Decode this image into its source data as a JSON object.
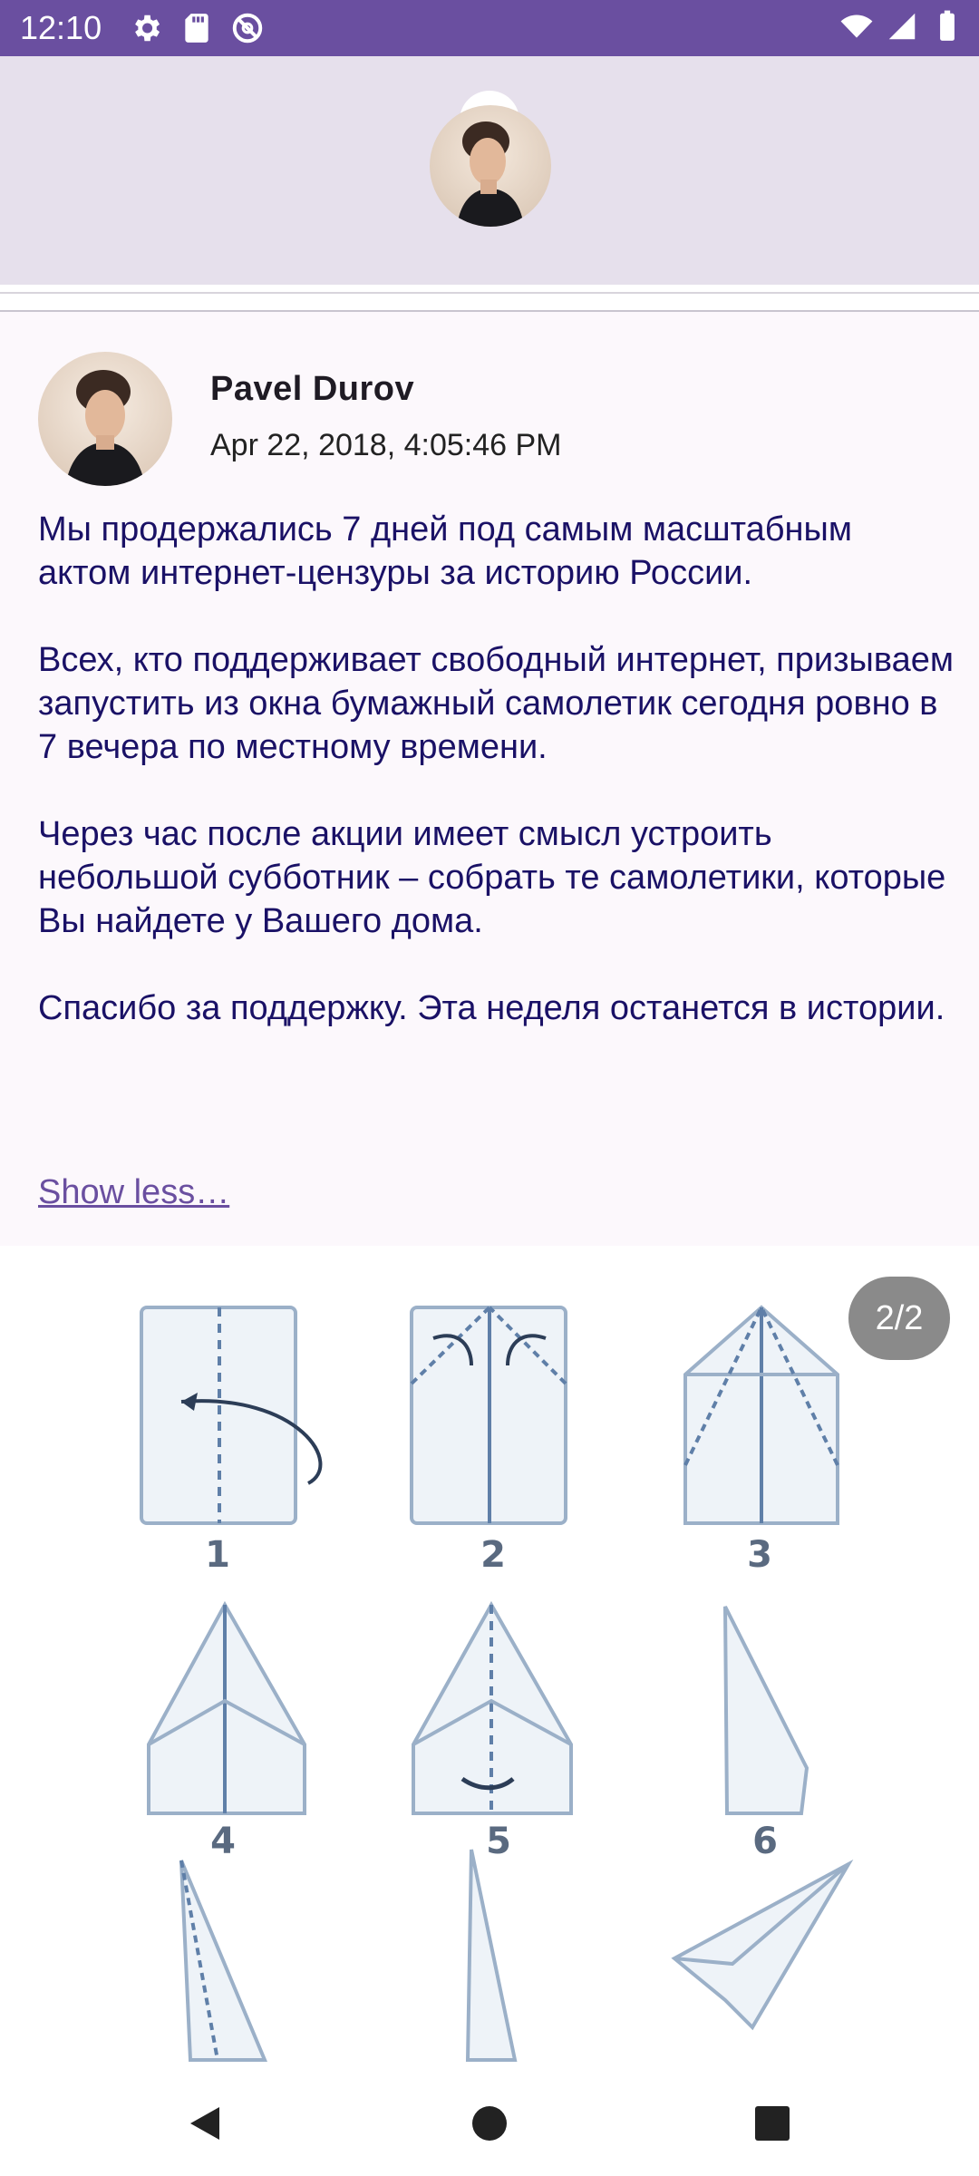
{
  "status_bar": {
    "time": "12:10",
    "icons_left": [
      "gear-icon",
      "sd-card-icon",
      "do-not-disturb-icon"
    ],
    "icons_right": [
      "wifi-icon",
      "signal-icon",
      "battery-icon"
    ]
  },
  "header": {
    "avatar_icon": "profile-avatar"
  },
  "post": {
    "author": "Pavel Durov",
    "date": "Apr 22, 2018, 4:05:46 PM",
    "text": "Мы продержались 7 дней под самым масштабным актом интернет-цензуры за историю России.\n\nВсех, кто поддерживает свободный интернет, призываем запустить из окна бумажный самолетик сегодня ровно в 7 вечера по местному времени.\n\nЧерез час после акции имеет смысл устроить небольшой субботник – собрать те самолетики, которые Вы найдете у Вашего дома.\n\nСпасибо за поддержку. Эта неделя останется в истории.",
    "show_less": "Show less…"
  },
  "image": {
    "counter": "2/2",
    "steps": [
      "1",
      "2",
      "3",
      "4",
      "5",
      "6"
    ]
  },
  "nav": {
    "back": "back-icon",
    "home": "home-icon",
    "recents": "recents-icon"
  },
  "colors": {
    "status_bar": "#6a4fa0",
    "header_bg": "#e6e0ec",
    "post_bg": "#fcf8fc",
    "post_text": "#1a1166",
    "link": "#6a4fa0"
  }
}
